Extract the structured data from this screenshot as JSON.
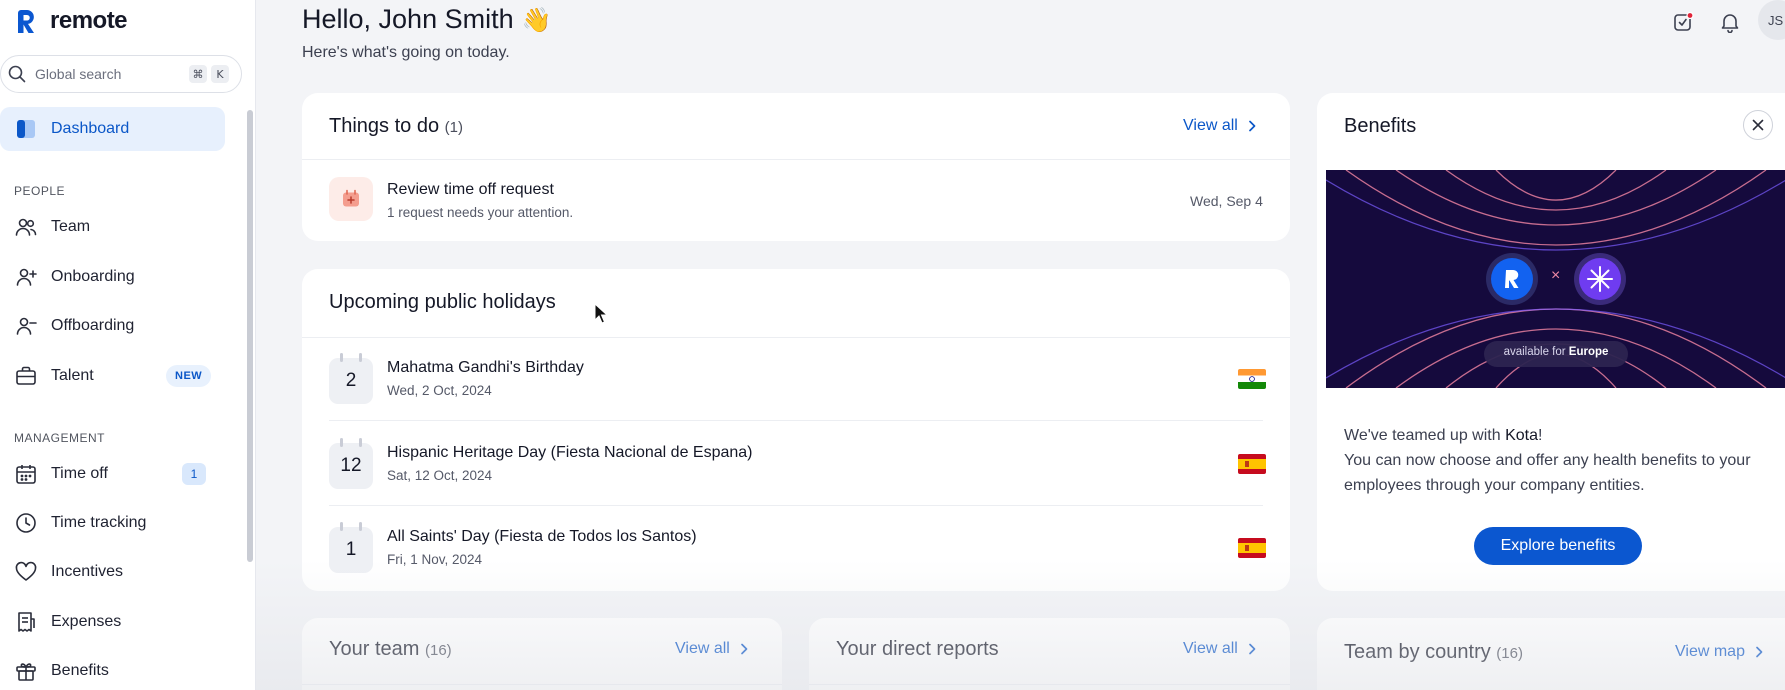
{
  "brand": {
    "name": "remote"
  },
  "search": {
    "placeholder": "Global search",
    "shortcut_keys": [
      "⌘",
      "K"
    ]
  },
  "sidebar": {
    "dashboard": "Dashboard",
    "people_section": "PEOPLE",
    "people_items": [
      {
        "label": "Team",
        "icon": "team-icon"
      },
      {
        "label": "Onboarding",
        "icon": "user-plus-icon"
      },
      {
        "label": "Offboarding",
        "icon": "user-minus-icon"
      },
      {
        "label": "Talent",
        "icon": "briefcase-icon",
        "badge": "NEW"
      }
    ],
    "management_section": "MANAGEMENT",
    "management_items": [
      {
        "label": "Time off",
        "icon": "calendar-icon",
        "badge": "1"
      },
      {
        "label": "Time tracking",
        "icon": "clock-icon"
      },
      {
        "label": "Incentives",
        "icon": "heart-icon"
      },
      {
        "label": "Expenses",
        "icon": "receipt-icon"
      },
      {
        "label": "Benefits",
        "icon": "gift-icon"
      }
    ]
  },
  "header": {
    "greeting": "Hello, John Smith",
    "wave": "👋",
    "subtitle": "Here's what's going on today.",
    "avatar_initials": "JS"
  },
  "todo": {
    "title": "Things to do",
    "count": "(1)",
    "view_all": "View all",
    "items": [
      {
        "title": "Review time off request",
        "subtitle": "1 request needs your attention.",
        "date": "Wed, Sep 4"
      }
    ]
  },
  "holidays": {
    "title": "Upcoming public holidays",
    "items": [
      {
        "day": "2",
        "name": "Mahatma Gandhi's Birthday",
        "date": "Wed, 2 Oct, 2024",
        "flag": "india"
      },
      {
        "day": "12",
        "name": "Hispanic Heritage Day (Fiesta Nacional de Espana)",
        "date": "Sat, 12 Oct, 2024",
        "flag": "spain"
      },
      {
        "day": "1",
        "name": "All Saints' Day (Fiesta de Todos los Santos)",
        "date": "Fri, 1 Nov, 2024",
        "flag": "spain"
      }
    ]
  },
  "benefits": {
    "title": "Benefits",
    "banner_text_prefix": "available for ",
    "banner_text_bold": "Europe",
    "banner_cross": "×",
    "line1_prefix": "We've teamed up with ",
    "line1_brand": "Kota",
    "line1_suffix": "!",
    "line2": "You can now choose and offer any health benefits to your employees through your company entities.",
    "button": "Explore benefits"
  },
  "your_team": {
    "title": "Your team",
    "count": "(16)",
    "view_all": "View all"
  },
  "direct_reports": {
    "title": "Your direct reports",
    "view_all": "View all"
  },
  "team_by_country": {
    "title": "Team by country",
    "count": "(16)",
    "view_map": "View map"
  },
  "colors": {
    "accent": "#0b57c8",
    "button": "#0b57d0",
    "active_bg": "#e7f0fd",
    "banner_bg": "#150a3d"
  }
}
